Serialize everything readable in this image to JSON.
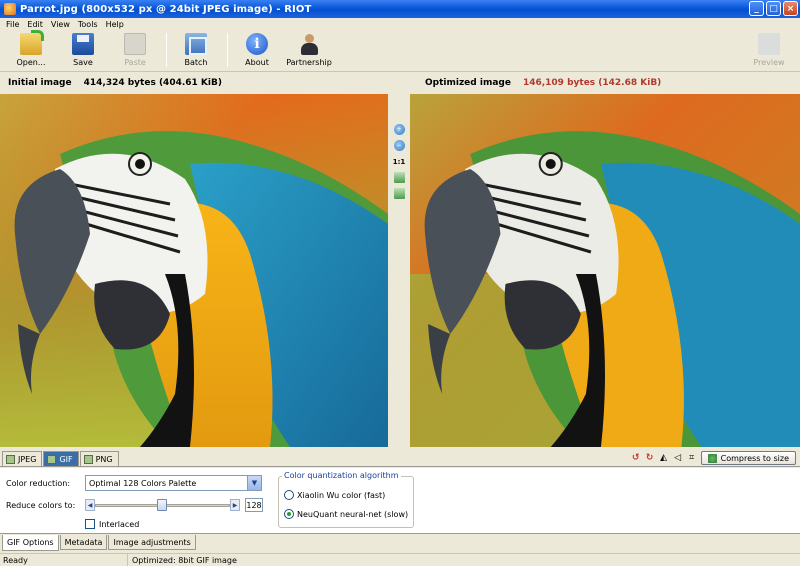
{
  "window": {
    "title": "Parrot.jpg (800x532 px @ 24bit JPEG image) - RIOT"
  },
  "menu": [
    "File",
    "Edit",
    "View",
    "Tools",
    "Help"
  ],
  "toolbar": {
    "open": "Open...",
    "save": "Save",
    "paste": "Paste",
    "batch": "Batch",
    "about": "About",
    "partnership": "Partnership",
    "preview": "Preview"
  },
  "initial": {
    "label": "Initial image",
    "size": "414,324 bytes (404.61 KiB)"
  },
  "optimized": {
    "label": "Optimized image",
    "size": "146,109 bytes (142.68 KiB)"
  },
  "zoom_label": "1:1",
  "formats": {
    "jpeg": "JPEG",
    "gif": "GIF",
    "png": "PNG",
    "active": "GIF"
  },
  "compress_button": "Compress to size",
  "options": {
    "color_reduction_label": "Color reduction:",
    "color_reduction_value": "Optimal 128 Colors Palette",
    "reduce_colors_label": "Reduce colors to:",
    "reduce_colors_value": "128",
    "interlaced_label": "Interlaced",
    "algorithm_group_title": "Color quantization algorithm",
    "algo_xiaolin": "Xiaolin Wu color (fast)",
    "algo_neuquant": "NeuQuant neural-net (slow)",
    "algo_selected": "NeuQuant neural-net (slow)"
  },
  "bottom_tabs": [
    "GIF Options",
    "Metadata",
    "Image adjustments"
  ],
  "status": {
    "left": "Ready",
    "right": "Optimized: 8bit GIF image"
  }
}
